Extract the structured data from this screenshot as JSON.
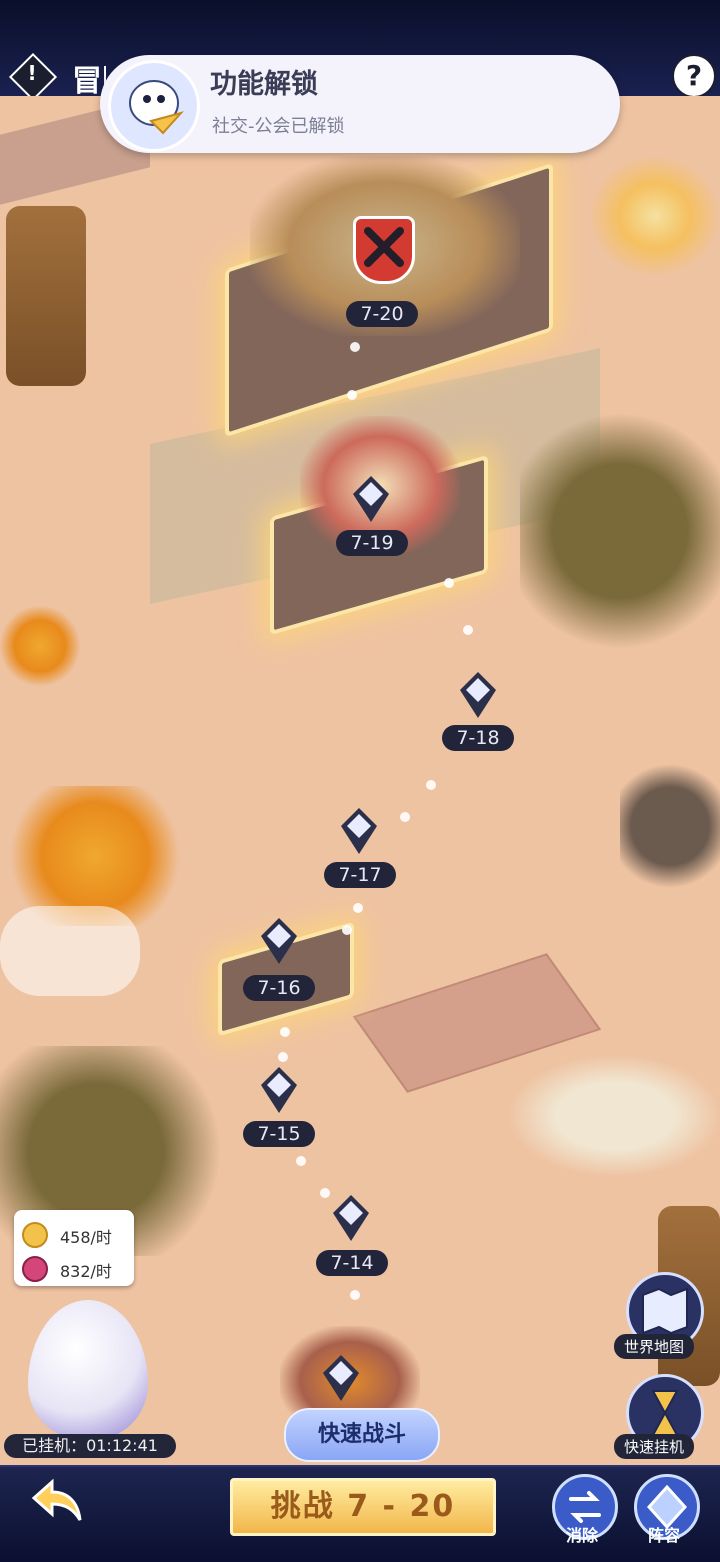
{
  "header": {
    "title_partial": "冒险",
    "help_icon": "?",
    "alert_icon": "!"
  },
  "toast": {
    "title": "功能解锁",
    "message": "社交-公会已解锁"
  },
  "levels": [
    {
      "label": "7-20"
    },
    {
      "label": "7-19"
    },
    {
      "label": "7-18"
    },
    {
      "label": "7-17"
    },
    {
      "label": "7-16"
    },
    {
      "label": "7-15"
    },
    {
      "label": "7-14"
    }
  ],
  "income": {
    "gold": "458/时",
    "gem": "832/时"
  },
  "idle_time": "已挂机：01:12:41",
  "buttons": {
    "quick_fight": "快速战斗",
    "challenge": "挑战 7 - 20",
    "world_map": "世界地图",
    "quick_idle": "快速挂机",
    "clear": "消除",
    "lineup": "阵容"
  },
  "colors": {
    "map": "#eec3a2",
    "bar": "#1a2150",
    "challenge": "#f2b64a"
  }
}
